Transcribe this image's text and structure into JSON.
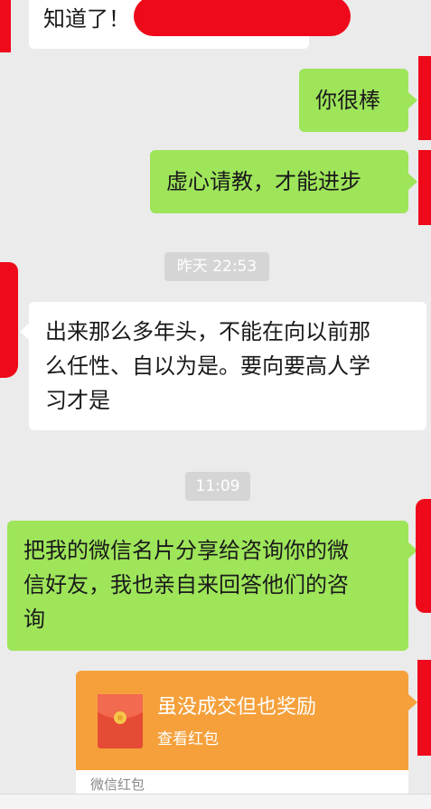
{
  "messages": {
    "m1": {
      "text": "知道了！"
    },
    "m2": {
      "text": "你很棒"
    },
    "m3": {
      "text": "虚心请教，才能进步"
    },
    "t1": {
      "text": "昨天 22:53"
    },
    "m4": {
      "lines": [
        "出来那么多年头，不能在向以前那",
        "么任性、自以为是。要向要高人学",
        "习才是"
      ]
    },
    "t2": {
      "text": "11:09"
    },
    "m5": {
      "lines": [
        "把我的微信名片分享给咨询你的微",
        "信好友，我也亲自来回答他们的咨",
        "询"
      ]
    },
    "red_packet": {
      "title": "虽没成交但也奖励",
      "subtitle": "查看红包",
      "footer": "微信红包"
    }
  },
  "colors": {
    "chat_bg": "#ebebeb",
    "sent_bubble": "#9ee55a",
    "received_bubble": "#ffffff",
    "red_packet": "#f5a03b",
    "redaction": "#ee0a1a"
  }
}
